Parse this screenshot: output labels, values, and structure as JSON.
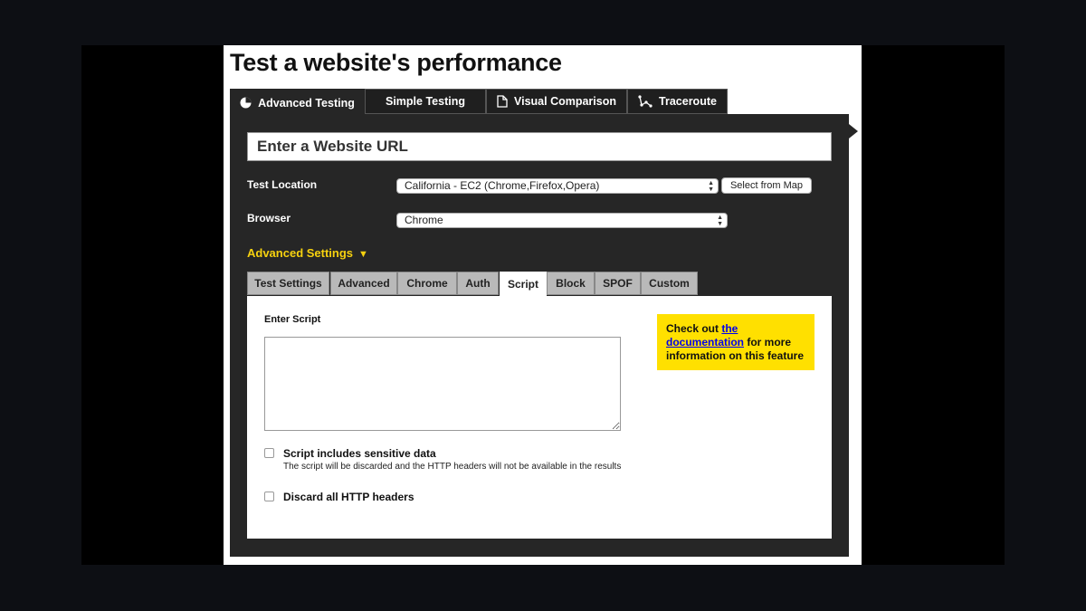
{
  "page": {
    "title": "Test a website's performance"
  },
  "main_tabs": [
    {
      "label": "Advanced Testing",
      "icon": "pie-chart-icon",
      "active": true
    },
    {
      "label": "Simple Testing",
      "active": false
    },
    {
      "label": "Visual Comparison",
      "icon": "document-icon",
      "active": false
    },
    {
      "label": "Traceroute",
      "icon": "traceroute-icon",
      "active": false
    }
  ],
  "form": {
    "url_placeholder": "Enter a Website URL",
    "test_location": {
      "label": "Test Location",
      "value": "California - EC2 (Chrome,Firefox,Opera)",
      "map_button": "Select from Map"
    },
    "browser": {
      "label": "Browser",
      "value": "Chrome"
    }
  },
  "advanced": {
    "label": "Advanced Settings",
    "toggle_glyph": "▼",
    "tabs": [
      "Test Settings",
      "Advanced",
      "Chrome",
      "Auth",
      "Script",
      "Block",
      "SPOF",
      "Custom"
    ],
    "active_tab": "Script"
  },
  "script_tab": {
    "enter_script_label": "Enter Script",
    "script_value": "",
    "info": {
      "prefix": "Check out ",
      "link": "the documentation",
      "suffix": " for more information on this feature"
    },
    "sensitive": {
      "label": "Script includes sensitive data",
      "help": "The script will be discarded and the HTTP headers will not be available in the results",
      "checked": false
    },
    "discard_headers": {
      "label": "Discard all HTTP headers",
      "checked": false
    }
  },
  "colors": {
    "panel": "#262626",
    "accent_yellow": "#f6d10f",
    "info_yellow": "#ffe000",
    "link": "#0000ee"
  }
}
